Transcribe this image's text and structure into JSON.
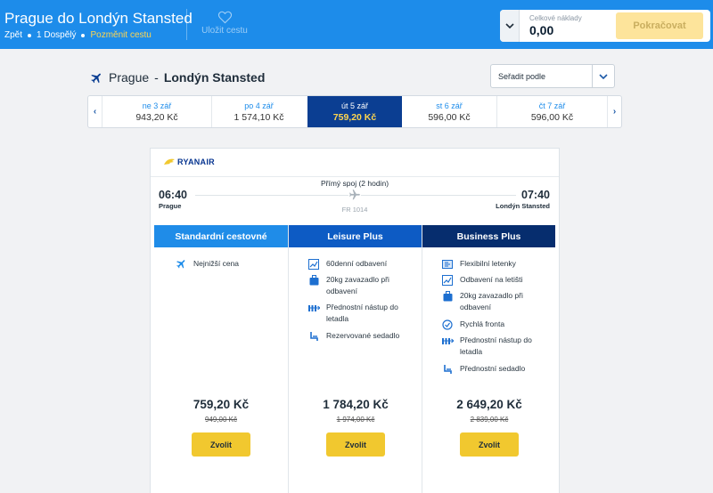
{
  "header": {
    "title": "Prague do Londýn Stansted",
    "back": "Zpět",
    "passengers": "1 Dospělý",
    "change": "Pozměnit cestu",
    "save": "Uložit cestu",
    "total_label": "Celkové náklady",
    "total_value": "0,00",
    "continue": "Pokračovat",
    "brand_color": "#1d8cea"
  },
  "route": {
    "origin": "Prague",
    "separator": "-",
    "destination": "Londýn Stansted",
    "sort_label": "Seřadit podle"
  },
  "dates": [
    {
      "day": "ne 3 zář",
      "price": "943,20 Kč"
    },
    {
      "day": "po 4 zář",
      "price": "1 574,10 Kč"
    },
    {
      "day": "út 5 zář",
      "price": "759,20 Kč",
      "selected": true
    },
    {
      "day": "st 6 zář",
      "price": "596,00 Kč"
    },
    {
      "day": "čt 7 zář",
      "price": "596,00 Kč"
    }
  ],
  "flight": {
    "airline": "RYANAIR",
    "type": "Přímý spoj (2 hodin)",
    "dep_time": "06:40",
    "dep_city": "Prague",
    "arr_time": "07:40",
    "arr_city": "Londýn Stansted",
    "flight_no": "FR 1014"
  },
  "fares": [
    {
      "name": "Standardní cestovné",
      "color": "#1f8ce8",
      "features": [
        {
          "icon": "plane-icon",
          "text": "Nejnižší cena"
        }
      ],
      "price": "759,20 Kč",
      "old_price": "949,00 Kč",
      "button": "Zvolit"
    },
    {
      "name": "Leisure Plus",
      "color": "#0d5bc4",
      "features": [
        {
          "icon": "chart-icon",
          "text": "60denní odbavení"
        },
        {
          "icon": "bag-icon",
          "text": "20kg zavazadlo při odbavení"
        },
        {
          "icon": "queue-icon",
          "text": "Přednostní nástup do letadla"
        },
        {
          "icon": "seat-icon",
          "text": "Rezervované sedadlo"
        }
      ],
      "price": "1 784,20 Kč",
      "old_price": "1 974,00 Kč",
      "button": "Zvolit"
    },
    {
      "name": "Business Plus",
      "color": "#062d6e",
      "features": [
        {
          "icon": "ticket-icon",
          "text": "Flexibilní letenky"
        },
        {
          "icon": "chart-icon",
          "text": "Odbavení na letišti"
        },
        {
          "icon": "bag-icon",
          "text": "20kg zavazadlo při odbavení"
        },
        {
          "icon": "fast-track-icon",
          "text": "Rychlá fronta"
        },
        {
          "icon": "queue-icon",
          "text": "Přednostní nástup do letadla"
        },
        {
          "icon": "seat-icon",
          "text": "Přednostní sedadlo"
        }
      ],
      "price": "2 649,20 Kč",
      "old_price": "2 839,00 Kč",
      "button": "Zvolit"
    }
  ]
}
